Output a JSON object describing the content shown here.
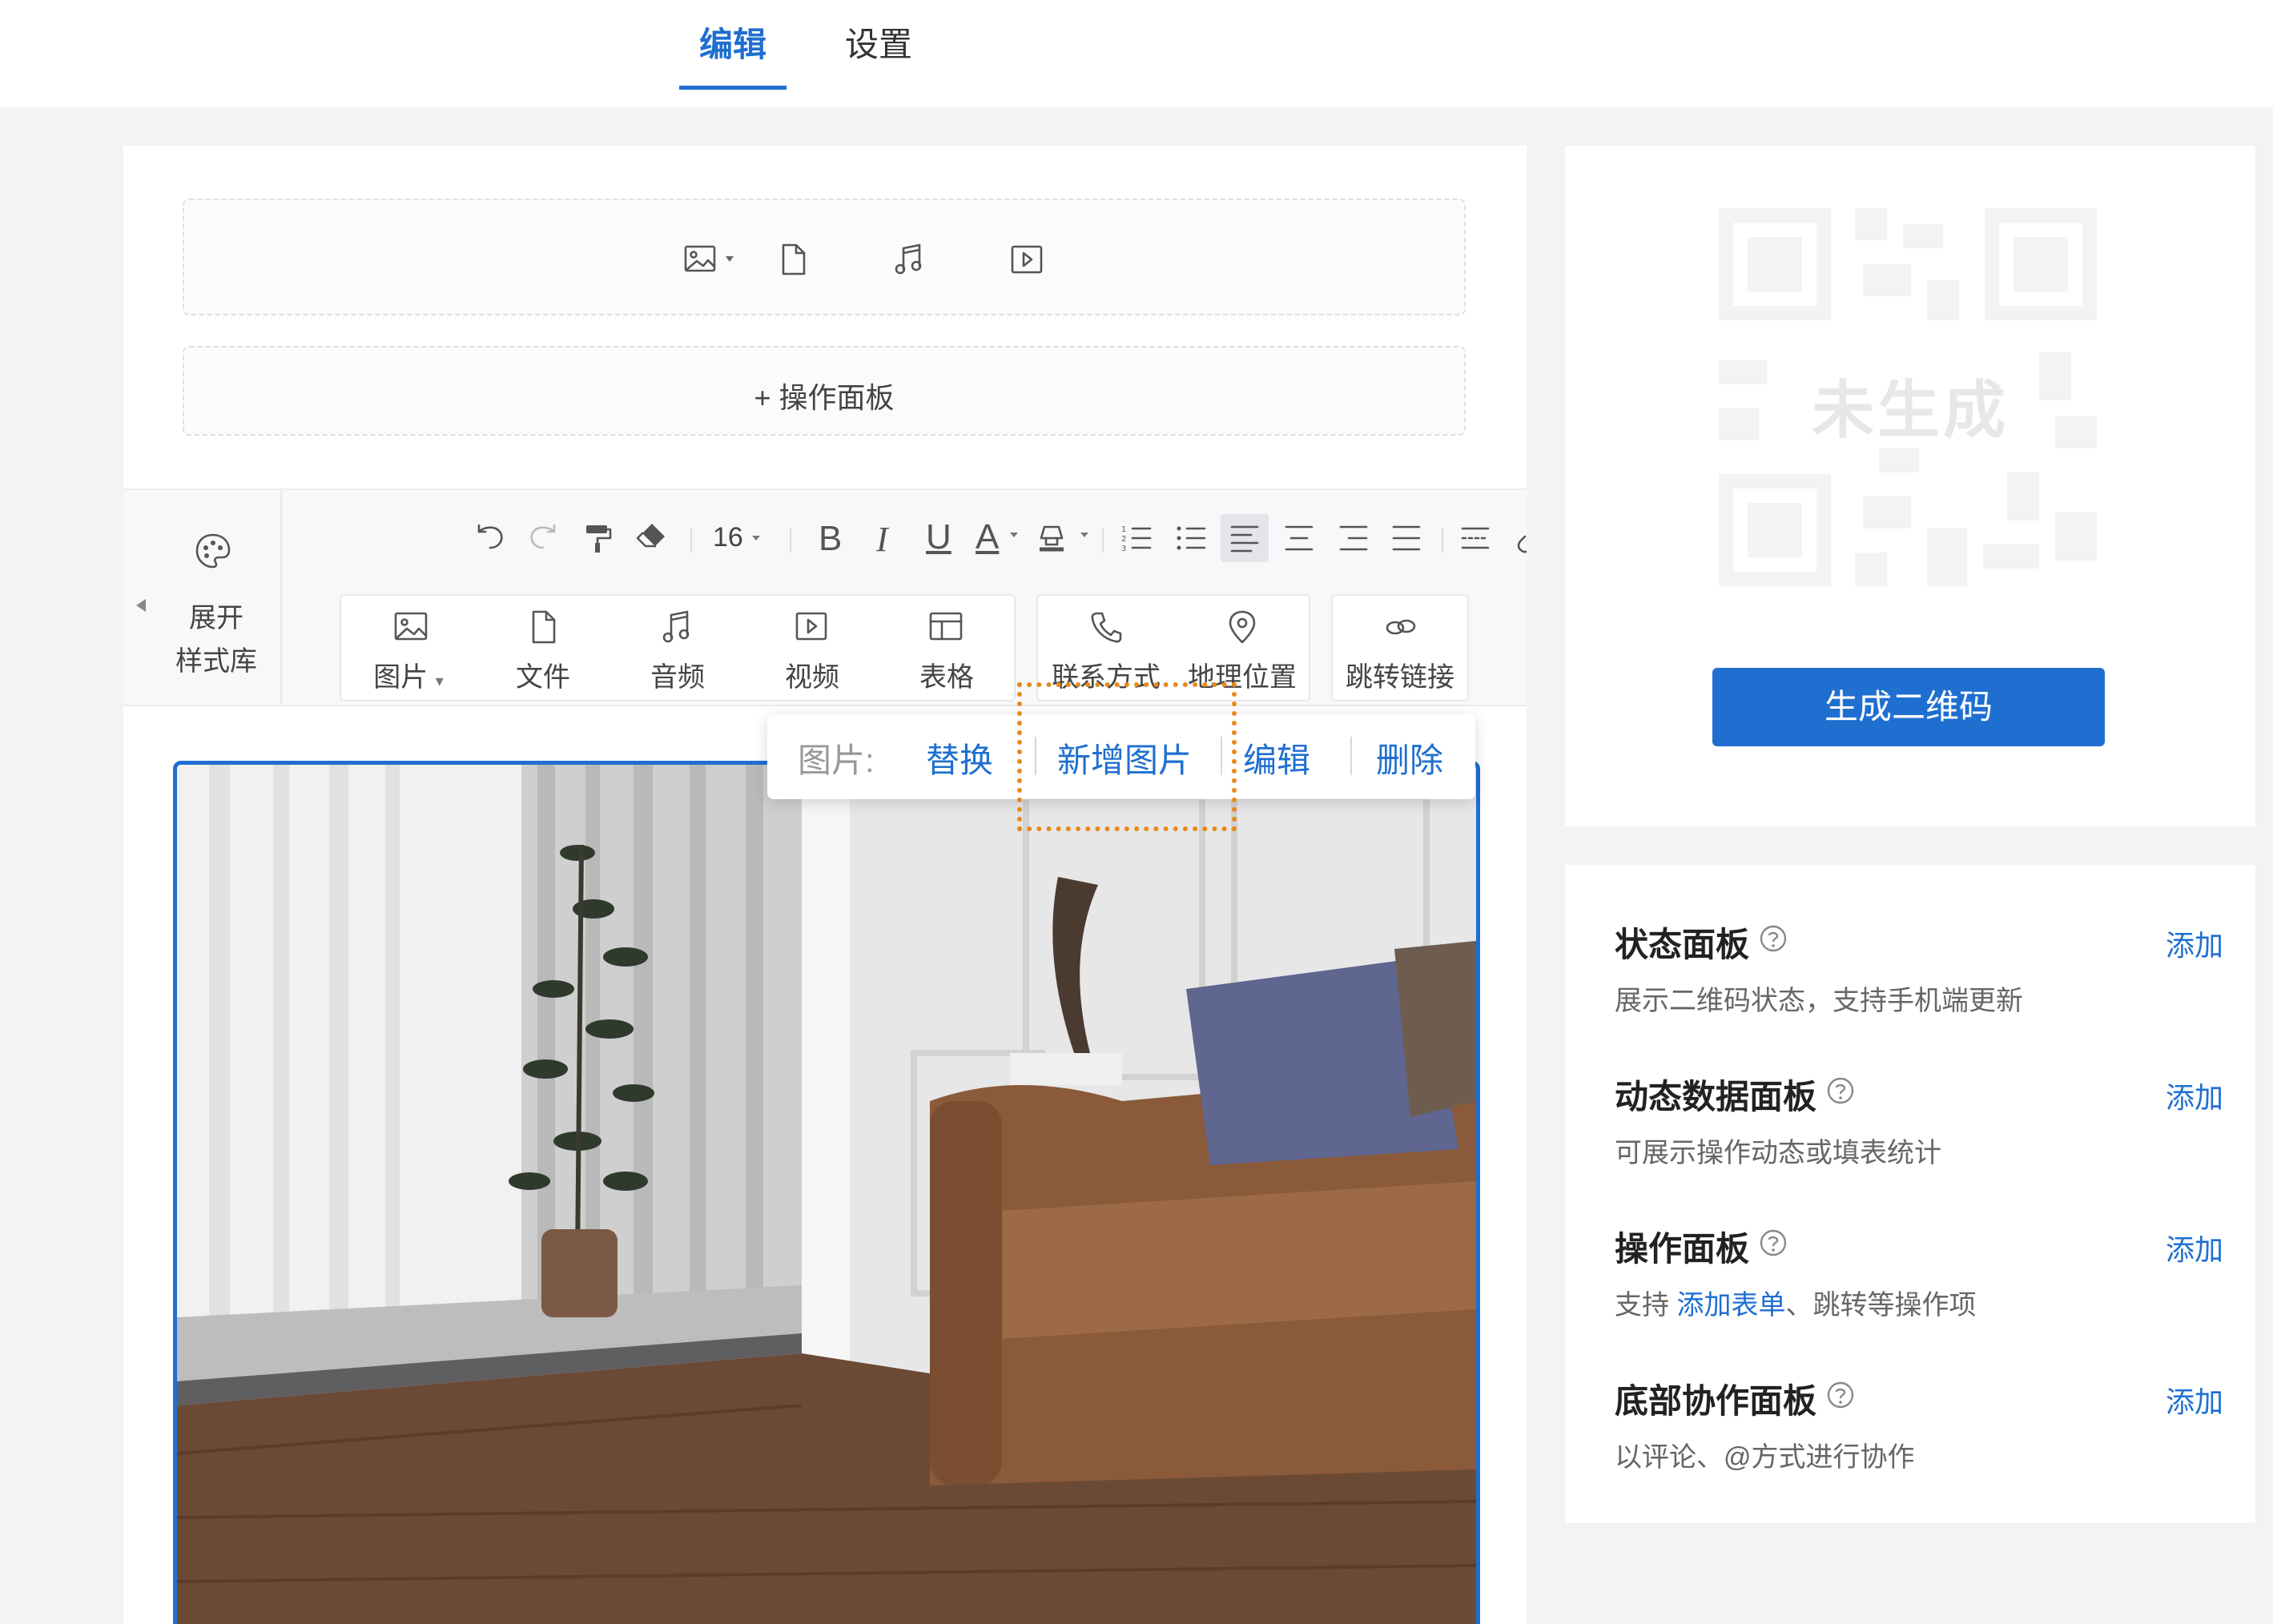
{
  "tabs": {
    "edit": "编辑",
    "settings": "设置"
  },
  "editor": {
    "add_panel": "+ 操作面板",
    "style_library": {
      "line1": "展开",
      "line2": "样式库"
    },
    "font_size": "16",
    "format_buttons": {
      "bold": "B",
      "italic": "I",
      "underline": "U",
      "font_color": "A"
    },
    "insert": {
      "image": "图片",
      "file": "文件",
      "audio": "音频",
      "video": "视频",
      "table": "表格",
      "contact": "联系方式",
      "location": "地理位置",
      "jump_link": "跳转链接"
    },
    "image_popup": {
      "label": "图片:",
      "replace": "替换",
      "add_image": "新增图片",
      "edit": "编辑",
      "delete": "删除"
    }
  },
  "qr": {
    "status": "未生成",
    "generate_button": "生成二维码"
  },
  "panels": [
    {
      "title": "状态面板",
      "desc": "展示二维码状态，支持手机端更新",
      "action": "添加"
    },
    {
      "title": "动态数据面板",
      "desc": "可展示操作动态或填表统计",
      "action": "添加"
    },
    {
      "title": "操作面板",
      "desc_prefix": "支持 ",
      "desc_link": "添加表单",
      "desc_suffix": "、跳转等操作项",
      "action": "添加"
    },
    {
      "title": "底部协作面板",
      "desc": "以评论、@方式进行协作",
      "action": "添加"
    }
  ],
  "colors": {
    "accent": "#1f6fd0",
    "highlight": "#e8891a"
  }
}
